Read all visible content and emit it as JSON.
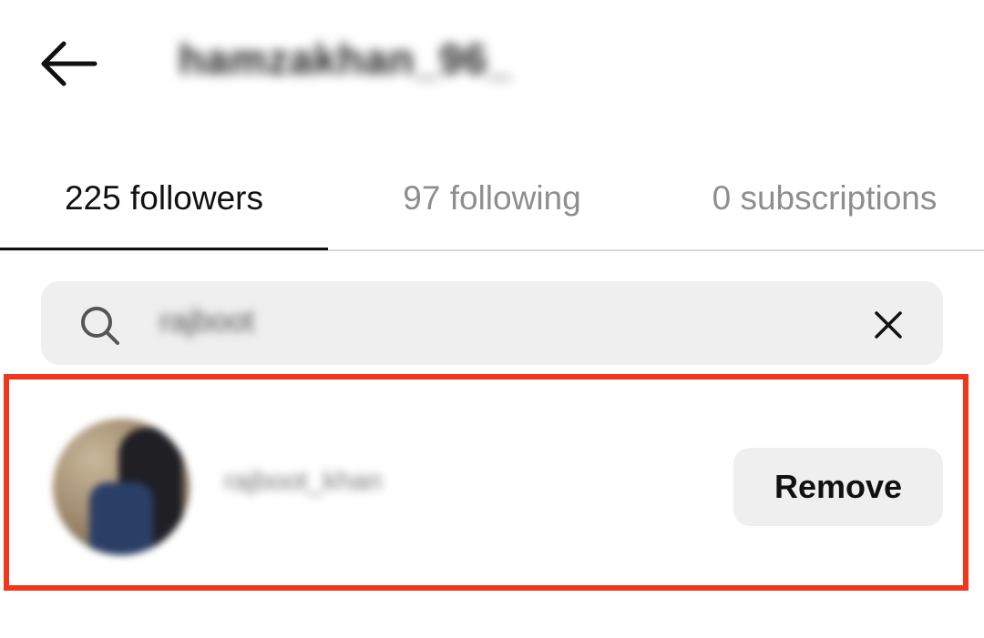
{
  "header": {
    "back_icon": "arrow-left-icon",
    "username": "hamzakhan_96_"
  },
  "tabs": [
    {
      "label": "225 followers",
      "active": true
    },
    {
      "label": "97 following",
      "active": false
    },
    {
      "label": "0 subscriptions",
      "active": false
    }
  ],
  "search": {
    "icon": "search-icon",
    "value": "rajboot",
    "clear_icon": "close-icon"
  },
  "result": {
    "avatar_icon": "avatar",
    "handle": "rajboot_khan",
    "action_label": "Remove"
  },
  "colors": {
    "highlight": "#f0361b",
    "search_bg": "#efefef",
    "button_bg": "#efefef",
    "active_tab": "#111111",
    "inactive_tab": "#8e8e8e"
  }
}
